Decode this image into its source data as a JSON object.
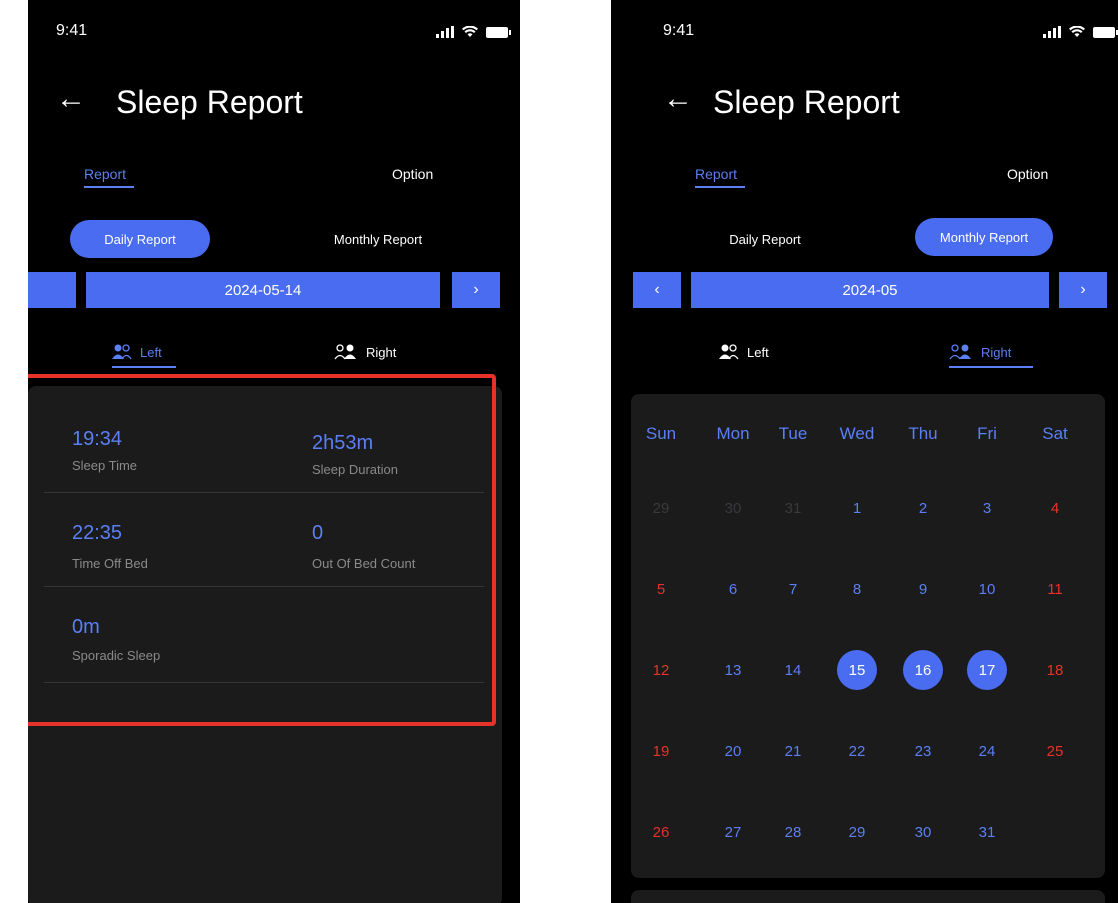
{
  "left_screen": {
    "status_time": "9:41",
    "title": "Sleep Report",
    "tabs": [
      "Report",
      "Option"
    ],
    "report_modes": [
      "Daily Report",
      "Monthly Report"
    ],
    "date": "2024-05-14",
    "next_arrow": "›",
    "sides": [
      "Left",
      "Right"
    ],
    "metrics": [
      {
        "value": "19:34",
        "label": "Sleep Time"
      },
      {
        "value": "2h53m",
        "label": "Sleep Duration"
      },
      {
        "value": "22:35",
        "label": "Time Off Bed"
      },
      {
        "value": "0",
        "label": "Out Of Bed Count"
      },
      {
        "value": "0m",
        "label": "Sporadic Sleep"
      }
    ]
  },
  "right_screen": {
    "status_time": "9:41",
    "title": "Sleep Report",
    "tabs": [
      "Report",
      "Option"
    ],
    "report_modes": [
      "Daily Report",
      "Monthly Report"
    ],
    "month": "2024-05",
    "prev_arrow": "‹",
    "next_arrow": "›",
    "sides": [
      "Left",
      "Right"
    ],
    "weekdays": [
      "Sun",
      "Mon",
      "Tue",
      "Wed",
      "Thu",
      "Fri",
      "Sat"
    ],
    "weeks": [
      [
        "29",
        "30",
        "31",
        "1",
        "2",
        "3",
        "4"
      ],
      [
        "5",
        "6",
        "7",
        "8",
        "9",
        "10",
        "11"
      ],
      [
        "12",
        "13",
        "14",
        "15",
        "16",
        "17",
        "18"
      ],
      [
        "19",
        "20",
        "21",
        "22",
        "23",
        "24",
        "25"
      ],
      [
        "26",
        "27",
        "28",
        "29",
        "30",
        "31",
        ""
      ]
    ],
    "muted_days": [
      "29",
      "30",
      "31"
    ],
    "selected_days": [
      "15",
      "16",
      "17"
    ]
  },
  "colors": {
    "accent": "#4a6cf0",
    "accent_text": "#5b7ff5",
    "weekend": "#e5332a",
    "highlight_border": "#e5332a",
    "card": "#1b1b1c",
    "background": "#000000"
  },
  "icons": [
    "back-arrow-icon",
    "signal-icon",
    "wifi-icon",
    "battery-icon",
    "person-left-icon",
    "person-right-icon"
  ]
}
